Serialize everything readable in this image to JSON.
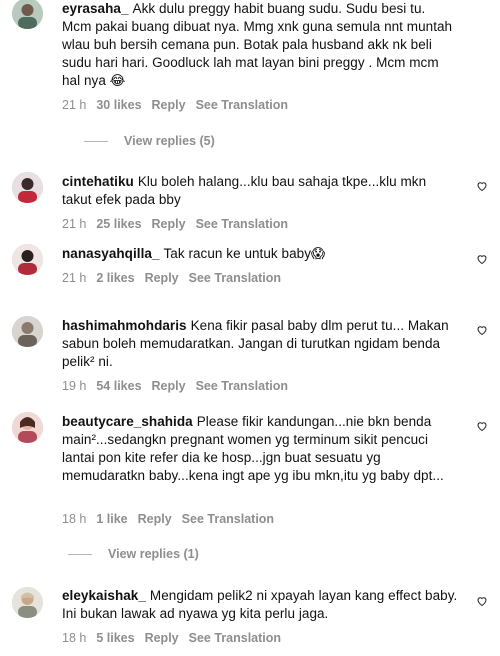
{
  "comments": [
    {
      "username": "eyrasaha_",
      "text": "Akk dulu preggy habit buang sudu. Sudu besi tu. Mcm pakai buang dibuat nya. Mmg xnk guna semula nnt muntah wlau buh bersih cemana pun. Botak pala husband akk nk beli sudu hari hari. Goodluck lah mat layan bini preggy . Mcm mcm hal nya 😂",
      "time": "21 h",
      "likes": "30 likes",
      "reply": "Reply",
      "translate": "See Translation",
      "view_replies": "View replies (5)"
    },
    {
      "username": "cintehatiku",
      "text": "Klu boleh halang...klu bau sahaja tkpe...klu mkn takut efek pada bby",
      "time": "21 h",
      "likes": "25 likes",
      "reply": "Reply",
      "translate": "See Translation"
    },
    {
      "username": "nanasyahqilla_",
      "text": "Tak racun ke untuk baby😱",
      "time": "21 h",
      "likes": "2 likes",
      "reply": "Reply",
      "translate": "See Translation"
    },
    {
      "username": "hashimahmohdaris",
      "text": "Kena fikir pasal baby dlm perut tu... Makan sabun boleh memudaratkan. Jangan di turutkan ngidam benda pelik² ni.",
      "time": "19 h",
      "likes": "54 likes",
      "reply": "Reply",
      "translate": "See Translation"
    },
    {
      "username": "beautycare_shahida",
      "text": "Please fikir kandungan...nie bkn benda main²...sedangkn pregnant women yg terminum sikit pencuci lantai pon kite refer dia ke hosp...jgn buat sesuatu yg memudaratkn baby...kena ingt ape yg ibu mkn,itu yg baby dpt...",
      "time": "18 h",
      "likes": "1 like",
      "reply": "Reply",
      "translate": "See Translation",
      "view_replies": "View replies (1)"
    },
    {
      "username": "eleykaishak_",
      "text": "Mengidam pelik2 ni xpayah layan kang effect baby. Ini bukan lawak ad nyawa yg kita perlu jaga.",
      "time": "18 h",
      "likes": "5 likes",
      "reply": "Reply",
      "translate": "See Translation"
    }
  ]
}
